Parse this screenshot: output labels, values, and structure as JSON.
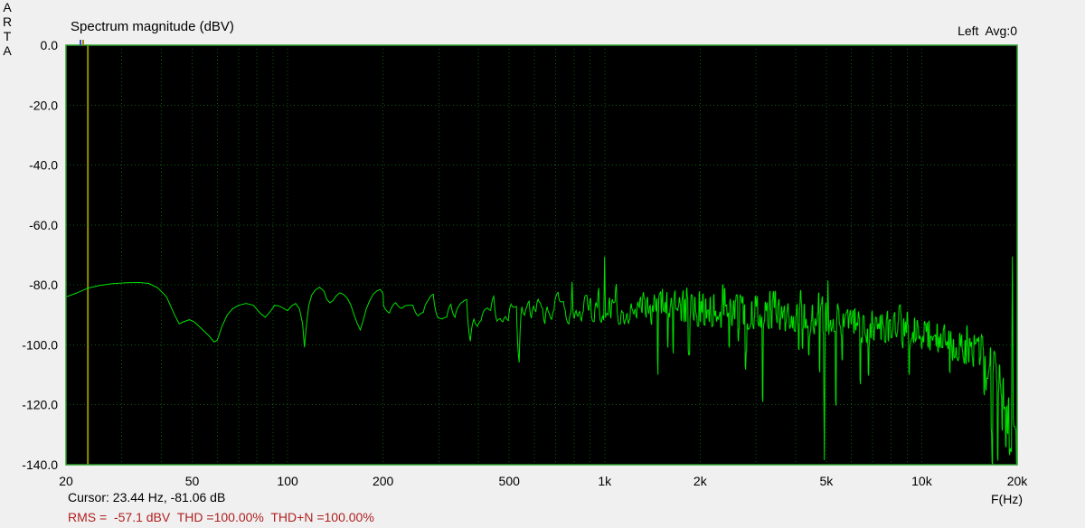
{
  "header": {
    "title": "Spectrum magnitude (dBV)",
    "channel_avg": "Left  Avg:0"
  },
  "branding": {
    "letters": [
      "A",
      "R",
      "T",
      "A"
    ]
  },
  "status": {
    "cursor_text": "Cursor: 23.44 Hz, -81.06 dB",
    "rms_text": "RMS =  -57.1 dBV  THD =100.00%  THD+N =100.00%"
  },
  "colors": {
    "page_bg": "#f0f0f0",
    "plot_bg": "#000000",
    "border": "#2aa02a",
    "grid": "#0d5c0d",
    "trace": "#00e100",
    "cursor_line": "#8f8f00",
    "text": "#000000",
    "status_red": "#b02020"
  },
  "chart_data": {
    "type": "line",
    "title": "Spectrum magnitude (dBV)",
    "xlabel": "F(Hz)",
    "ylabel": "dBV",
    "x_scale": "log",
    "xlim": [
      20,
      20000
    ],
    "ylim": [
      -140,
      0
    ],
    "grid": "dashed dark-green; verticals at log minor steps, horizontals every 20 dB",
    "legend_position": "none",
    "channel": "Left",
    "avg_count": 0,
    "cursor": {
      "freq_hz": 23.44,
      "level_db": -81.06
    },
    "stats": {
      "rms_dbv": -57.1,
      "thd_pct": 100.0,
      "thdn_pct": 100.0
    },
    "xticks": [
      {
        "f": 20,
        "label": "20"
      },
      {
        "f": 50,
        "label": "50"
      },
      {
        "f": 100,
        "label": "100"
      },
      {
        "f": 200,
        "label": "200"
      },
      {
        "f": 500,
        "label": "500"
      },
      {
        "f": 1000,
        "label": "1k"
      },
      {
        "f": 2000,
        "label": "2k"
      },
      {
        "f": 5000,
        "label": "5k"
      },
      {
        "f": 10000,
        "label": "10k"
      },
      {
        "f": 20000,
        "label": "20k"
      }
    ],
    "yticks": [
      {
        "v": 0,
        "label": "0.0"
      },
      {
        "v": -20,
        "label": "-20.0"
      },
      {
        "v": -40,
        "label": "-40.0"
      },
      {
        "v": -60,
        "label": "-60.0"
      },
      {
        "v": -80,
        "label": "-80.0"
      },
      {
        "v": -100,
        "label": "-100.0"
      },
      {
        "v": -120,
        "label": "-120.0"
      },
      {
        "v": -140,
        "label": "-140.0"
      }
    ],
    "smooth_curve_points": [
      [
        20,
        -84
      ],
      [
        21.5,
        -82.8
      ],
      [
        23.44,
        -81.06
      ],
      [
        25.5,
        -80.2
      ],
      [
        28,
        -79.6
      ],
      [
        31,
        -79.3
      ],
      [
        34,
        -79.2
      ],
      [
        36.5,
        -79.5
      ],
      [
        39,
        -81
      ],
      [
        41.5,
        -84
      ],
      [
        44,
        -90
      ],
      [
        45.5,
        -93
      ],
      [
        47,
        -92.3
      ],
      [
        49,
        -91.6
      ],
      [
        51,
        -92.5
      ],
      [
        54,
        -95
      ],
      [
        56.5,
        -97
      ],
      [
        58.5,
        -99
      ],
      [
        60,
        -98.5
      ],
      [
        62,
        -94
      ],
      [
        64.5,
        -90
      ],
      [
        67,
        -88
      ],
      [
        70,
        -86.8
      ],
      [
        74,
        -86.2
      ],
      [
        78,
        -86.8
      ],
      [
        82,
        -89.5
      ],
      [
        85,
        -90.8
      ],
      [
        88,
        -89
      ],
      [
        91,
        -86.8
      ],
      [
        94,
        -87
      ],
      [
        97,
        -87.8
      ],
      [
        100,
        -88.6
      ],
      [
        103,
        -87
      ],
      [
        106,
        -86.2
      ],
      [
        109,
        -88
      ],
      [
        111.5,
        -93
      ],
      [
        113,
        -100.8
      ],
      [
        114.5,
        -94
      ],
      [
        116.5,
        -87
      ],
      [
        119,
        -83.5
      ],
      [
        122,
        -81.8
      ],
      [
        126,
        -80.8
      ],
      [
        130,
        -82
      ],
      [
        133,
        -84.8
      ],
      [
        136,
        -86
      ],
      [
        139,
        -85.2
      ],
      [
        142,
        -83.8
      ],
      [
        146,
        -82.6
      ],
      [
        150,
        -83.2
      ],
      [
        154,
        -84.4
      ],
      [
        158,
        -86.5
      ],
      [
        162,
        -90
      ],
      [
        166,
        -93
      ],
      [
        169.5,
        -95
      ],
      [
        173,
        -92
      ],
      [
        177,
        -88
      ],
      [
        181,
        -85.5
      ],
      [
        186,
        -83.2
      ],
      [
        191,
        -82
      ],
      [
        196,
        -81.5
      ],
      [
        200,
        -83
      ]
    ],
    "noise_region": {
      "start_hz": 200,
      "mean_envelope": [
        [
          200,
          -86.5
        ],
        [
          250,
          -87.5
        ],
        [
          300,
          -88
        ],
        [
          400,
          -88.5
        ],
        [
          500,
          -88
        ],
        [
          700,
          -88
        ],
        [
          1000,
          -87.5
        ],
        [
          1400,
          -88
        ],
        [
          2000,
          -88
        ],
        [
          2800,
          -89
        ],
        [
          4000,
          -90.5
        ],
        [
          5000,
          -91.5
        ],
        [
          6500,
          -93.5
        ],
        [
          8000,
          -95
        ],
        [
          10000,
          -97
        ],
        [
          12000,
          -99
        ],
        [
          14000,
          -101
        ],
        [
          15500,
          -103.5
        ],
        [
          16500,
          -107
        ],
        [
          17500,
          -112
        ],
        [
          18500,
          -119
        ],
        [
          19300,
          -124
        ],
        [
          19700,
          -128
        ],
        [
          20000,
          -131
        ]
      ],
      "peak_amp_db": 7.5,
      "down_spike_probability": 0.055,
      "up_peak_probability": 0.06,
      "down_spike_tail_db": 6.5,
      "bottom_fill_above_hz": 16500,
      "noise_seed": 1337
    },
    "spikes": [
      [
        1000,
        -70.5
      ],
      [
        790,
        -79
      ],
      [
        5060,
        -78.5
      ],
      [
        4930,
        -138.5
      ],
      [
        19300,
        -70.5
      ]
    ]
  }
}
